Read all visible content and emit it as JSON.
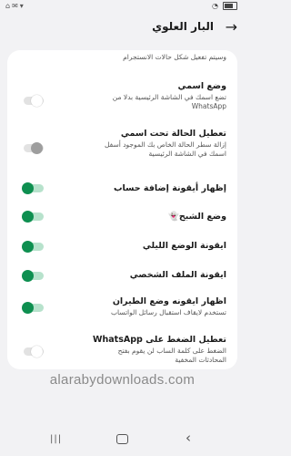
{
  "status_bar": {
    "left_icons": [
      "notification-icon",
      "notification-icon",
      "signal-icon"
    ],
    "right_icons": [
      "wifi-icon",
      "battery-icon"
    ]
  },
  "header": {
    "title": "البار العلوي"
  },
  "top_partial_text": "وسيتم تفعيل شكل حالات الانستجرام",
  "settings": [
    {
      "title": "وضع اسمي",
      "description": "تضع اسمك في الشاشة الرئيسية بدلا من WhatsApp",
      "toggle": "off"
    },
    {
      "title": "تعطيل الحالة تحت اسمي",
      "description": "إزالة سطر الحالة الخاص بك الموجود أسفل اسمك في الشاشة الرئيسية",
      "toggle": "off-disabled"
    },
    {
      "title": "إظهار أيقونة إضافة حساب",
      "description": "",
      "toggle": "on"
    },
    {
      "title": "وضع الشبح👻",
      "description": "",
      "toggle": "on"
    },
    {
      "title": "ايقونة الوضع الليلي",
      "description": "",
      "toggle": "on"
    },
    {
      "title": "ايقونة الملف الشخصي",
      "description": "",
      "toggle": "on"
    },
    {
      "title": "اظهار ايقونه وضع الطيران",
      "description": "تستخدم لايقاف استقبال رسائل الواتساب",
      "toggle": "on"
    },
    {
      "title": "تعطيل الضغط على WhatsApp",
      "description": "الضغط على كلمة الساب لن يقوم بفتح المحادثات المخفية",
      "toggle": "off"
    }
  ],
  "watermark": "alarabydownloads.com",
  "nav_bar": {
    "recent": "|||",
    "back": "‹"
  }
}
